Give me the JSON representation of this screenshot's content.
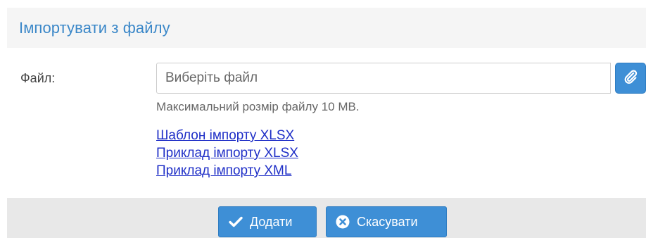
{
  "dialog": {
    "title": "Імпортувати з файлу"
  },
  "file_field": {
    "label": "Файл:",
    "placeholder": "Виберіть файл",
    "help_text": "Максимальний розмір файлу 10 MB.",
    "attach_icon": "paperclip-icon"
  },
  "links": [
    {
      "label": "Шаблон імпорту XLSX"
    },
    {
      "label": "Приклад імпорту XLSX"
    },
    {
      "label": "Приклад імпорту XML"
    }
  ],
  "footer": {
    "add_label": "Додати",
    "add_icon": "check-icon",
    "cancel_label": "Скасувати",
    "cancel_icon": "close-circle-icon"
  },
  "colors": {
    "accent": "#3e8fd6",
    "title": "#3a87c8",
    "link": "#1f2fc7"
  }
}
